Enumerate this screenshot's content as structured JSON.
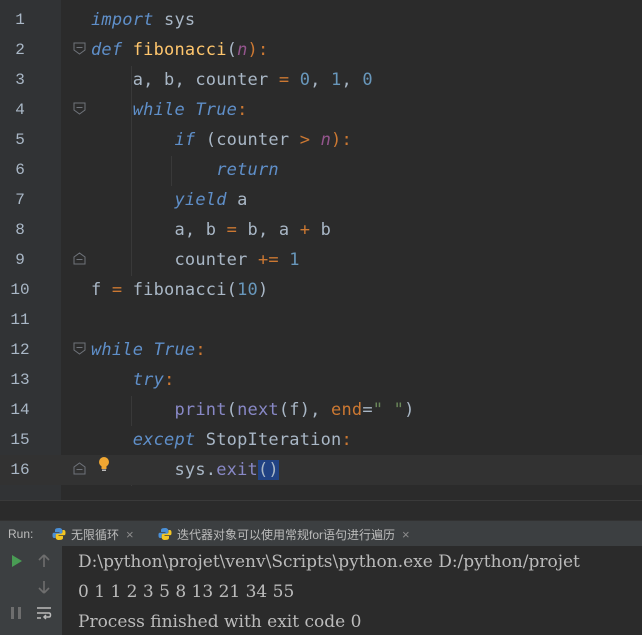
{
  "editor": {
    "line_numbers": [
      "1",
      "2",
      "3",
      "4",
      "5",
      "6",
      "7",
      "8",
      "9",
      "10",
      "11",
      "12",
      "13",
      "14",
      "15",
      "16"
    ],
    "lines": [
      [
        {
          "t": "import",
          "c": "kwb"
        },
        {
          "t": " sys",
          "c": "name"
        }
      ],
      [
        {
          "t": "def",
          "c": "kwb"
        },
        {
          "t": " ",
          "c": "name"
        },
        {
          "t": "fibonacci",
          "c": "fn"
        },
        {
          "t": "(",
          "c": "name"
        },
        {
          "t": "n",
          "c": "pm"
        },
        {
          "t": "):",
          "c": "pc"
        }
      ],
      [
        {
          "t": "    a, b, counter ",
          "c": "name"
        },
        {
          "t": "=",
          "c": "op"
        },
        {
          "t": " ",
          "c": "name"
        },
        {
          "t": "0",
          "c": "num"
        },
        {
          "t": ", ",
          "c": "name"
        },
        {
          "t": "1",
          "c": "num"
        },
        {
          "t": ", ",
          "c": "name"
        },
        {
          "t": "0",
          "c": "num"
        }
      ],
      [
        {
          "t": "    ",
          "c": "name"
        },
        {
          "t": "while",
          "c": "kwb"
        },
        {
          "t": " ",
          "c": "name"
        },
        {
          "t": "True",
          "c": "kwb"
        },
        {
          "t": ":",
          "c": "pc"
        }
      ],
      [
        {
          "t": "        ",
          "c": "name"
        },
        {
          "t": "if",
          "c": "kwb"
        },
        {
          "t": " (counter ",
          "c": "name"
        },
        {
          "t": ">",
          "c": "op"
        },
        {
          "t": " ",
          "c": "name"
        },
        {
          "t": "n",
          "c": "pm"
        },
        {
          "t": "):",
          "c": "pc"
        }
      ],
      [
        {
          "t": "            ",
          "c": "name"
        },
        {
          "t": "return",
          "c": "kwb"
        }
      ],
      [
        {
          "t": "        ",
          "c": "name"
        },
        {
          "t": "yield",
          "c": "kwb"
        },
        {
          "t": " a",
          "c": "name"
        }
      ],
      [
        {
          "t": "        a, b ",
          "c": "name"
        },
        {
          "t": "=",
          "c": "op"
        },
        {
          "t": " b, a ",
          "c": "name"
        },
        {
          "t": "+",
          "c": "op"
        },
        {
          "t": " b",
          "c": "name"
        }
      ],
      [
        {
          "t": "        counter ",
          "c": "name"
        },
        {
          "t": "+=",
          "c": "op"
        },
        {
          "t": " ",
          "c": "name"
        },
        {
          "t": "1",
          "c": "num"
        }
      ],
      [
        {
          "t": "f ",
          "c": "name"
        },
        {
          "t": "=",
          "c": "op"
        },
        {
          "t": " fibonacci(",
          "c": "name"
        },
        {
          "t": "10",
          "c": "num"
        },
        {
          "t": ")",
          "c": "name"
        }
      ],
      [],
      [
        {
          "t": "while",
          "c": "kwb"
        },
        {
          "t": " ",
          "c": "name"
        },
        {
          "t": "True",
          "c": "kwb"
        },
        {
          "t": ":",
          "c": "pc"
        }
      ],
      [
        {
          "t": "    ",
          "c": "name"
        },
        {
          "t": "try",
          "c": "kwb"
        },
        {
          "t": ":",
          "c": "pc"
        }
      ],
      [
        {
          "t": "        ",
          "c": "name"
        },
        {
          "t": "print",
          "c": "bi"
        },
        {
          "t": "(",
          "c": "name"
        },
        {
          "t": "next",
          "c": "bi"
        },
        {
          "t": "(f), ",
          "c": "name"
        },
        {
          "t": "end",
          "c": "op"
        },
        {
          "t": "=",
          "c": "name"
        },
        {
          "t": "\" \"",
          "c": "str"
        },
        {
          "t": ")",
          "c": "name"
        }
      ],
      [
        {
          "t": "    ",
          "c": "name"
        },
        {
          "t": "except",
          "c": "kwb"
        },
        {
          "t": " StopIteration",
          "c": "name"
        },
        {
          "t": ":",
          "c": "pc"
        }
      ],
      [
        {
          "t": "        sys.",
          "c": "name"
        },
        {
          "t": "exit",
          "c": "bi"
        },
        {
          "t": "()",
          "c": "name"
        }
      ]
    ],
    "current_line": 16
  },
  "run_panel": {
    "label": "Run:",
    "tabs": [
      {
        "label": "无限循环",
        "close": "×"
      },
      {
        "label": "迭代器对象可以使用常规for语句进行遍历",
        "close": "×"
      }
    ]
  },
  "console": {
    "lines": [
      "D:\\python\\projet\\venv\\Scripts\\python.exe D:/python/projet",
      "0 1 1 2 3 5 8 13 21 34 55",
      "Process finished with exit code 0"
    ]
  },
  "colors": {
    "background": "#2b2b2b",
    "gutter": "#313335",
    "keyword": "#5f8fc9",
    "function": "#ffc66d",
    "number": "#6897bb",
    "parameter": "#94558d",
    "operator": "#cc7832",
    "string": "#6a8759",
    "builtin": "#8888c6"
  },
  "icons": {
    "fold": "fold-marker-icon",
    "bulb": "lightbulb-icon",
    "run": "run-icon",
    "up": "arrow-up-icon",
    "down": "arrow-down-icon",
    "pause": "pause-icon",
    "wrap": "soft-wrap-icon",
    "python": "python-file-icon"
  }
}
